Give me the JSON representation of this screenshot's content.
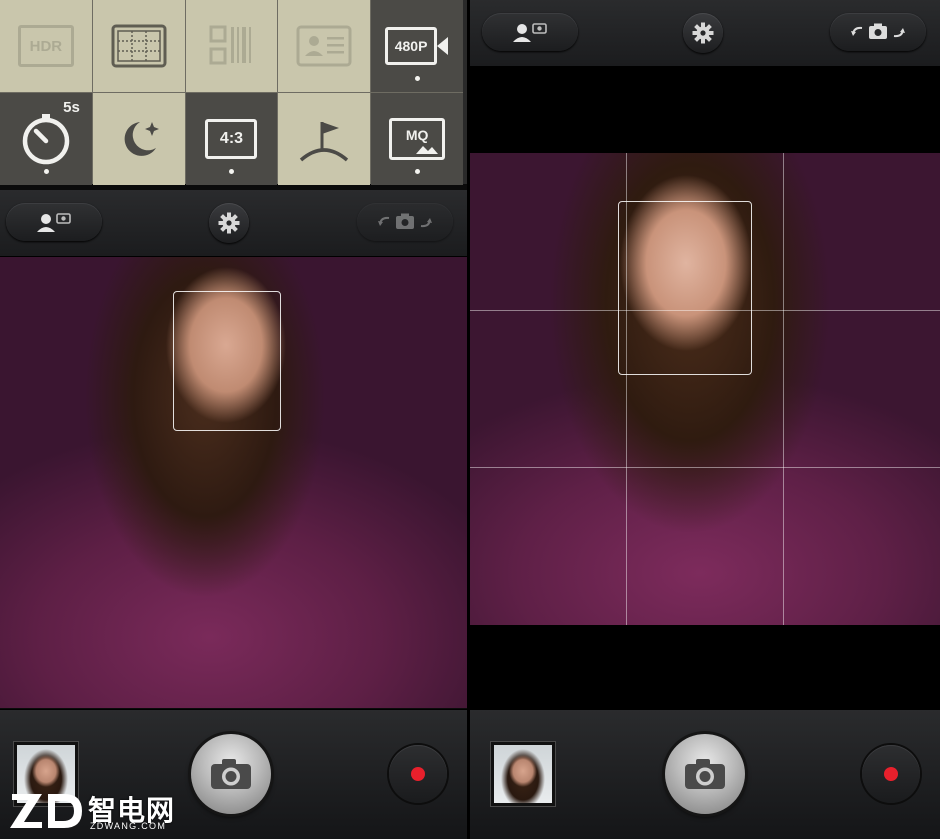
{
  "left_screen": {
    "quick_settings": {
      "row1": [
        {
          "key": "hdr",
          "label": "HDR",
          "active": false
        },
        {
          "key": "grid",
          "label": "",
          "active": false
        },
        {
          "key": "qr",
          "label": "",
          "active": false
        },
        {
          "key": "card",
          "label": "",
          "active": false
        },
        {
          "key": "video_resolution",
          "label": "480P",
          "active": true
        }
      ],
      "row2": [
        {
          "key": "timer",
          "label": "5s",
          "active": true
        },
        {
          "key": "night",
          "label": "",
          "active": false
        },
        {
          "key": "aspect_ratio",
          "label": "4:3",
          "active": true
        },
        {
          "key": "scene",
          "label": "",
          "active": false
        },
        {
          "key": "video_quality",
          "label": "MQ",
          "active": true
        }
      ]
    }
  },
  "watermark": {
    "cn": "智电网",
    "en": "ZDWANG.COM"
  },
  "colors": {
    "panel_bg": "#c9c6ac",
    "panel_active": "#4b4a46",
    "record_red": "#e8202c",
    "bar_dark": "#1b1c1e"
  }
}
